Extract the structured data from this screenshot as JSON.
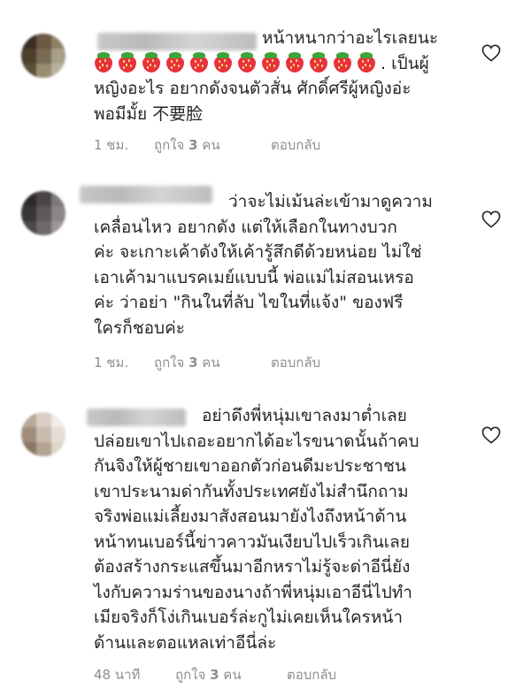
{
  "comments": [
    {
      "text_lines": [
        "หน้าหนากว่าอะไรเลยนะ",
        ". เป็นผู้",
        "หญิงอะไร อยากดังจนตัวสั่น ศักดิ์ศรีผู้หญิงอ่ะ",
        "พอมีมั้ย 不要脸"
      ],
      "emoji": "strawberry",
      "emoji_count": 12,
      "time": "1 ชม.",
      "likes_prefix": "ถูกใจ",
      "likes_count": "3",
      "likes_suffix": "คน",
      "reply": "ตอบกลับ",
      "avatar_colors": [
        "#3a2d22",
        "#6b5a44",
        "#8f8163",
        "#4b3f2d",
        "#7a6b52",
        "#a8a089",
        "#5c4f3a",
        "#9a8e72",
        "#b7b29e"
      ]
    },
    {
      "text_lines": [
        "ว่าจะไม่เม้นล่ะเข้ามาดูความ",
        "เคลื่อนไหว อยากดัง แต่ให้เลือกในทางบวก",
        "ค่ะ จะเกาะเค้าดังให้เค้ารู้สึกดีด้วยหน่อย ไม่ใช่",
        "เอาเค้ามาแบรคเมย์แบบนี้ พ่อแม่ไม่สอนเหรอ",
        "ค่ะ ว่าอย่า \"กินในที่ลับ ไขในที่แจ้ง\" ของฟรี",
        "ใครก็ชอบค่ะ"
      ],
      "time": "1 ชม.",
      "likes_prefix": "ถูกใจ",
      "likes_count": "3",
      "likes_suffix": "คน",
      "reply": "ตอบกลับ",
      "avatar_colors": [
        "#2b2a2c",
        "#4a4648",
        "#7d787a",
        "#3a3638",
        "#5e595b",
        "#8c8688",
        "#4d494b",
        "#6e6a6c",
        "#9b9698"
      ]
    },
    {
      "text_lines": [
        "อย่าดึงพี่หนุ่มเขาลงมาต่ำเลย",
        "ปล่อยเขาไปเถอะอยากได้อะไรขนาดนั้นถ้าคบ",
        "กันจิงให้ผู้ชายเขาออกตัวก่อนดีมะประชาชน",
        "เขาประนามด่ากันทั้งประเทศยังไม่สำนึกถาม",
        "จริงพ่อแม่เลี้ยงมาสังสอนมายังไงถึงหน้าด้าน",
        "หน้าทนเบอร์นี้ข่าวคาวมันเงียบไปเร็วเกินเลย",
        "ต้องสร้างกระแสขึ้นมาอีกหราไม่รู้จะด่าอีนี่ยัง",
        "ไงกับความร่านของนางถ้าพี่หนุ่มเอาอีนี่ไปทำ",
        "เมียจริงก็โง่เกินเบอร์ล่ะกูไม่เคยเห็นใครหน้า",
        "ด้านและตอแหลเท่าอีนี่ล่ะ"
      ],
      "time": "48 นาที",
      "likes_prefix": "ถูกใจ",
      "likes_count": "3",
      "likes_suffix": "คน",
      "reply": "ตอบกลับ",
      "avatar_colors": [
        "#b8a898",
        "#d9cfc6",
        "#f0ebe6",
        "#a08c7a",
        "#c9bcae",
        "#e5ded6",
        "#8a7766",
        "#b3a393",
        "#ddd4ca"
      ]
    }
  ],
  "colors": {
    "text": "#262626",
    "meta": "#8e8e8e",
    "heart_outline": "#262626"
  },
  "icons": {
    "like": "heart-outline-icon",
    "emoji": "strawberry-emoji-icon"
  }
}
